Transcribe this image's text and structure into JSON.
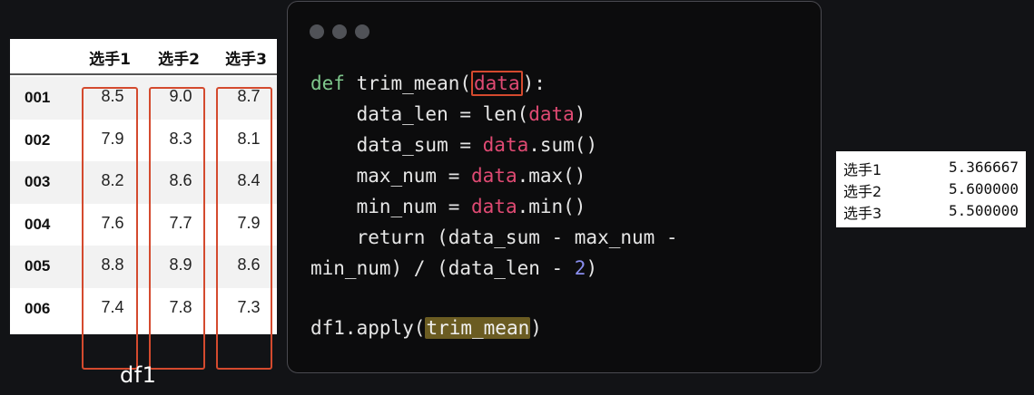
{
  "table": {
    "columns": [
      "选手1",
      "选手2",
      "选手3"
    ],
    "rows": [
      {
        "index": "001",
        "values": [
          "8.5",
          "9.0",
          "8.7"
        ]
      },
      {
        "index": "002",
        "values": [
          "7.9",
          "8.3",
          "8.1"
        ]
      },
      {
        "index": "003",
        "values": [
          "8.2",
          "8.6",
          "8.4"
        ]
      },
      {
        "index": "004",
        "values": [
          "7.6",
          "7.7",
          "7.9"
        ]
      },
      {
        "index": "005",
        "values": [
          "8.8",
          "8.9",
          "8.6"
        ]
      },
      {
        "index": "006",
        "values": [
          "7.4",
          "7.8",
          "7.3"
        ]
      }
    ],
    "caption": "df1",
    "highlight_color": "#d44a2e"
  },
  "code": {
    "l1_def": "def",
    "l1_name": " trim_mean(",
    "l1_arg": "data",
    "l1_end": "):",
    "l2_a": "    data_len = len(",
    "l2_var": "data",
    "l2_b": ")",
    "l3_a": "    data_sum = ",
    "l3_var": "data",
    "l3_b": ".sum()",
    "l4_a": "    max_num = ",
    "l4_var": "data",
    "l4_b": ".max()",
    "l5_a": "    min_num = ",
    "l5_var": "data",
    "l5_b": ".min()",
    "l6": "    return (data_sum - max_num -",
    "l7_a": "min_num) / (data_len - ",
    "l7_num": "2",
    "l7_b": ")",
    "l9_a": "df1.apply(",
    "l9_fn": "trim_mean",
    "l9_b": ")"
  },
  "result": [
    {
      "name": "选手1",
      "value": "5.366667"
    },
    {
      "name": "选手2",
      "value": "5.600000"
    },
    {
      "name": "选手3",
      "value": "5.500000"
    }
  ],
  "colors": {
    "background": "#121316",
    "keyword": "#7ec78c",
    "variable": "#e04a73",
    "number": "#8a8ef0",
    "function_highlight": "#6b5c22"
  }
}
